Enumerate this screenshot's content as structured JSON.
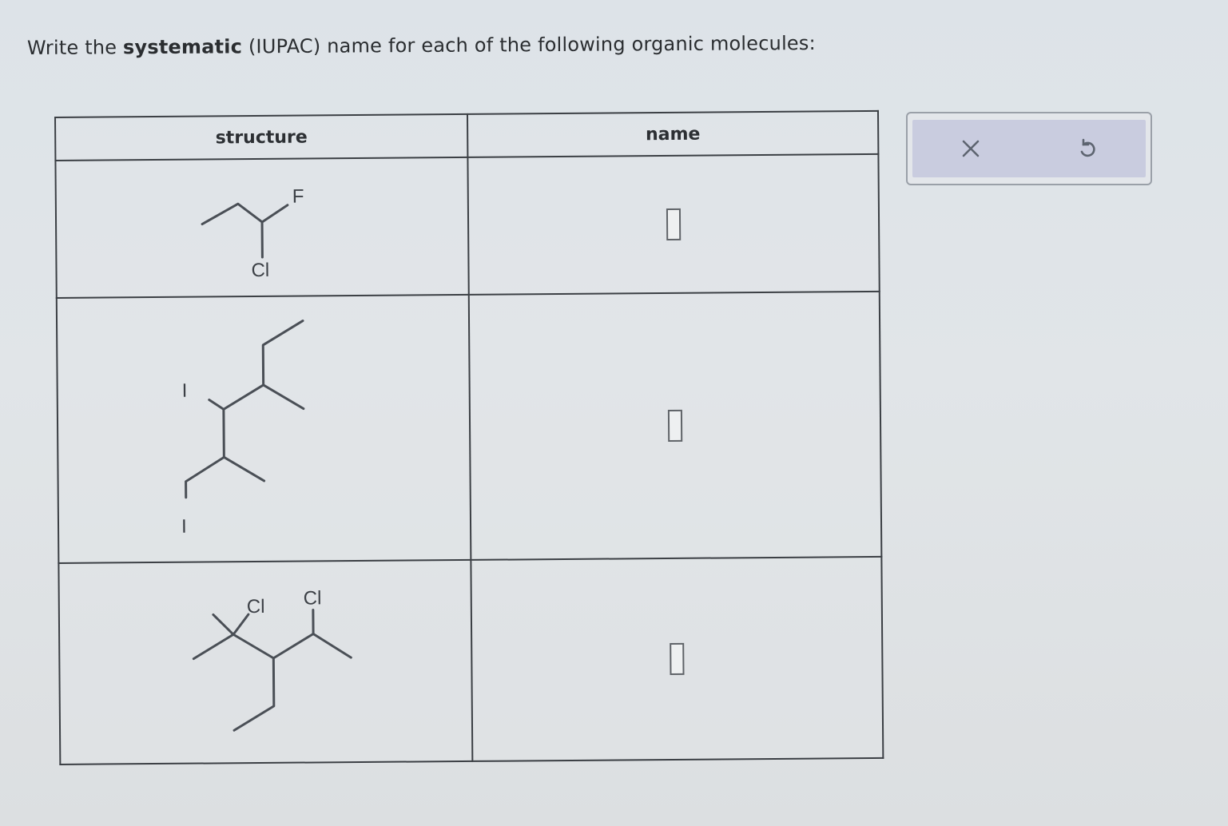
{
  "instruction": {
    "prefix": "Write the ",
    "bold": "systematic",
    "suffix": " (IUPAC) name for each of the following organic molecules:"
  },
  "table": {
    "headers": {
      "structure": "structure",
      "name": "name"
    },
    "rows": [
      {
        "labels": {
          "a": "F",
          "b": "Cl"
        },
        "answer": ""
      },
      {
        "labels": {
          "a": "I",
          "b": "I"
        },
        "answer": ""
      },
      {
        "labels": {
          "a": "Cl",
          "b": "Cl"
        },
        "answer": ""
      }
    ]
  },
  "toolbar": {
    "clear_icon": "x-icon",
    "undo_icon": "undo-icon"
  },
  "colors": {
    "toolbar_fill": "#c9ccdf",
    "border": "#3b3f44"
  }
}
